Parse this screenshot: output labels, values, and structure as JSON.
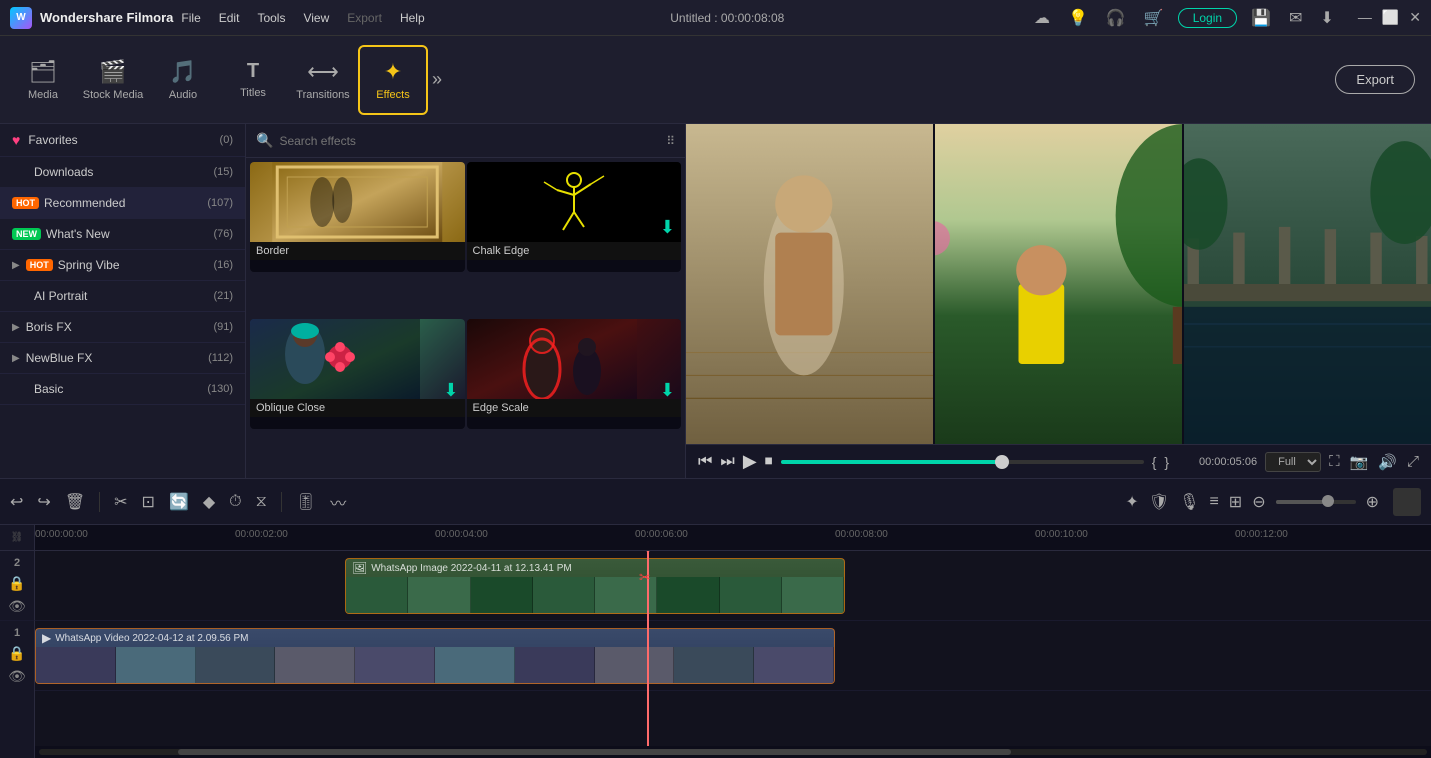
{
  "app": {
    "name": "Wondershare Filmora",
    "logo_letter": "W",
    "title": "Untitled : 00:00:08:08"
  },
  "menu": {
    "items": [
      "File",
      "Edit",
      "Tools",
      "View",
      "Export",
      "Help"
    ]
  },
  "toolbar": {
    "items": [
      {
        "id": "media",
        "icon": "🗂",
        "label": "Media"
      },
      {
        "id": "stock-media",
        "icon": "🎬",
        "label": "Stock Media"
      },
      {
        "id": "audio",
        "icon": "🎵",
        "label": "Audio"
      },
      {
        "id": "titles",
        "icon": "T",
        "label": "Titles"
      },
      {
        "id": "transitions",
        "icon": "⟷",
        "label": "Transitions"
      },
      {
        "id": "effects",
        "icon": "✦",
        "label": "Effects"
      }
    ],
    "more_label": "»",
    "export_label": "Export"
  },
  "sidebar": {
    "items": [
      {
        "id": "favorites",
        "label": "Favorites",
        "count": "(0)",
        "badge": null,
        "has_heart": true
      },
      {
        "id": "downloads",
        "label": "Downloads",
        "count": "(15)",
        "badge": null
      },
      {
        "id": "recommended",
        "label": "Recommended",
        "count": "(107)",
        "badge": "HOT"
      },
      {
        "id": "whats-new",
        "label": "What's New",
        "count": "(76)",
        "badge": "NEW"
      },
      {
        "id": "spring-vibe",
        "label": "Spring Vibe",
        "count": "(16)",
        "badge": "HOT",
        "expandable": true
      },
      {
        "id": "ai-portrait",
        "label": "AI Portrait",
        "count": "(21)",
        "expandable": false
      },
      {
        "id": "boris-fx",
        "label": "Boris FX",
        "count": "(91)",
        "expandable": true
      },
      {
        "id": "newblue-fx",
        "label": "NewBlue FX",
        "count": "(112)",
        "expandable": true
      },
      {
        "id": "basic",
        "label": "Basic",
        "count": "(130)"
      }
    ]
  },
  "effects_panel": {
    "search_placeholder": "Search effects",
    "effects": [
      {
        "id": "border",
        "name": "Border",
        "has_download": false,
        "type": "border"
      },
      {
        "id": "chalk-edge",
        "name": "Chalk Edge",
        "has_download": true,
        "type": "chalk"
      },
      {
        "id": "oblique-close",
        "name": "Oblique Close",
        "has_download": true,
        "type": "oblique"
      },
      {
        "id": "edge-scale",
        "name": "Edge Scale",
        "has_download": true,
        "type": "edge"
      }
    ]
  },
  "preview": {
    "time_current": "00:00:05:06",
    "quality": "Full",
    "progress_percent": 62
  },
  "timeline": {
    "toolbar_icons": [
      "undo",
      "redo",
      "delete",
      "cut",
      "crop",
      "motion",
      "keyframe",
      "mask",
      "speed",
      "audio",
      "color"
    ],
    "ruler_labels": [
      "00:00:00:00",
      "00:00:02:00",
      "00:00:04:00",
      "00:00:06:00",
      "00:00:08:00",
      "00:00:10:00",
      "00:00:12:00"
    ],
    "playhead_position": "00:00:05:00",
    "tracks": [
      {
        "num": "2",
        "clips": [
          {
            "label": "WhatsApp Image 2022-04-11 at 12.13.41 PM",
            "left_percent": 30,
            "width_percent": 40,
            "type": "image-strip"
          }
        ]
      },
      {
        "num": "1",
        "clips": [
          {
            "label": "WhatsApp Video 2022-04-12 at 2.09.56 PM",
            "left_percent": 0,
            "width_percent": 65,
            "type": "video-strip"
          }
        ]
      }
    ]
  },
  "title_bar_icons": {
    "cloud": "☁",
    "bulb": "💡",
    "headphone": "🎧",
    "cart": "🛒",
    "login": "Login",
    "save": "💾",
    "mail": "✉",
    "download": "⬇",
    "minimize": "—",
    "maximize": "⬜",
    "close": "✕"
  }
}
